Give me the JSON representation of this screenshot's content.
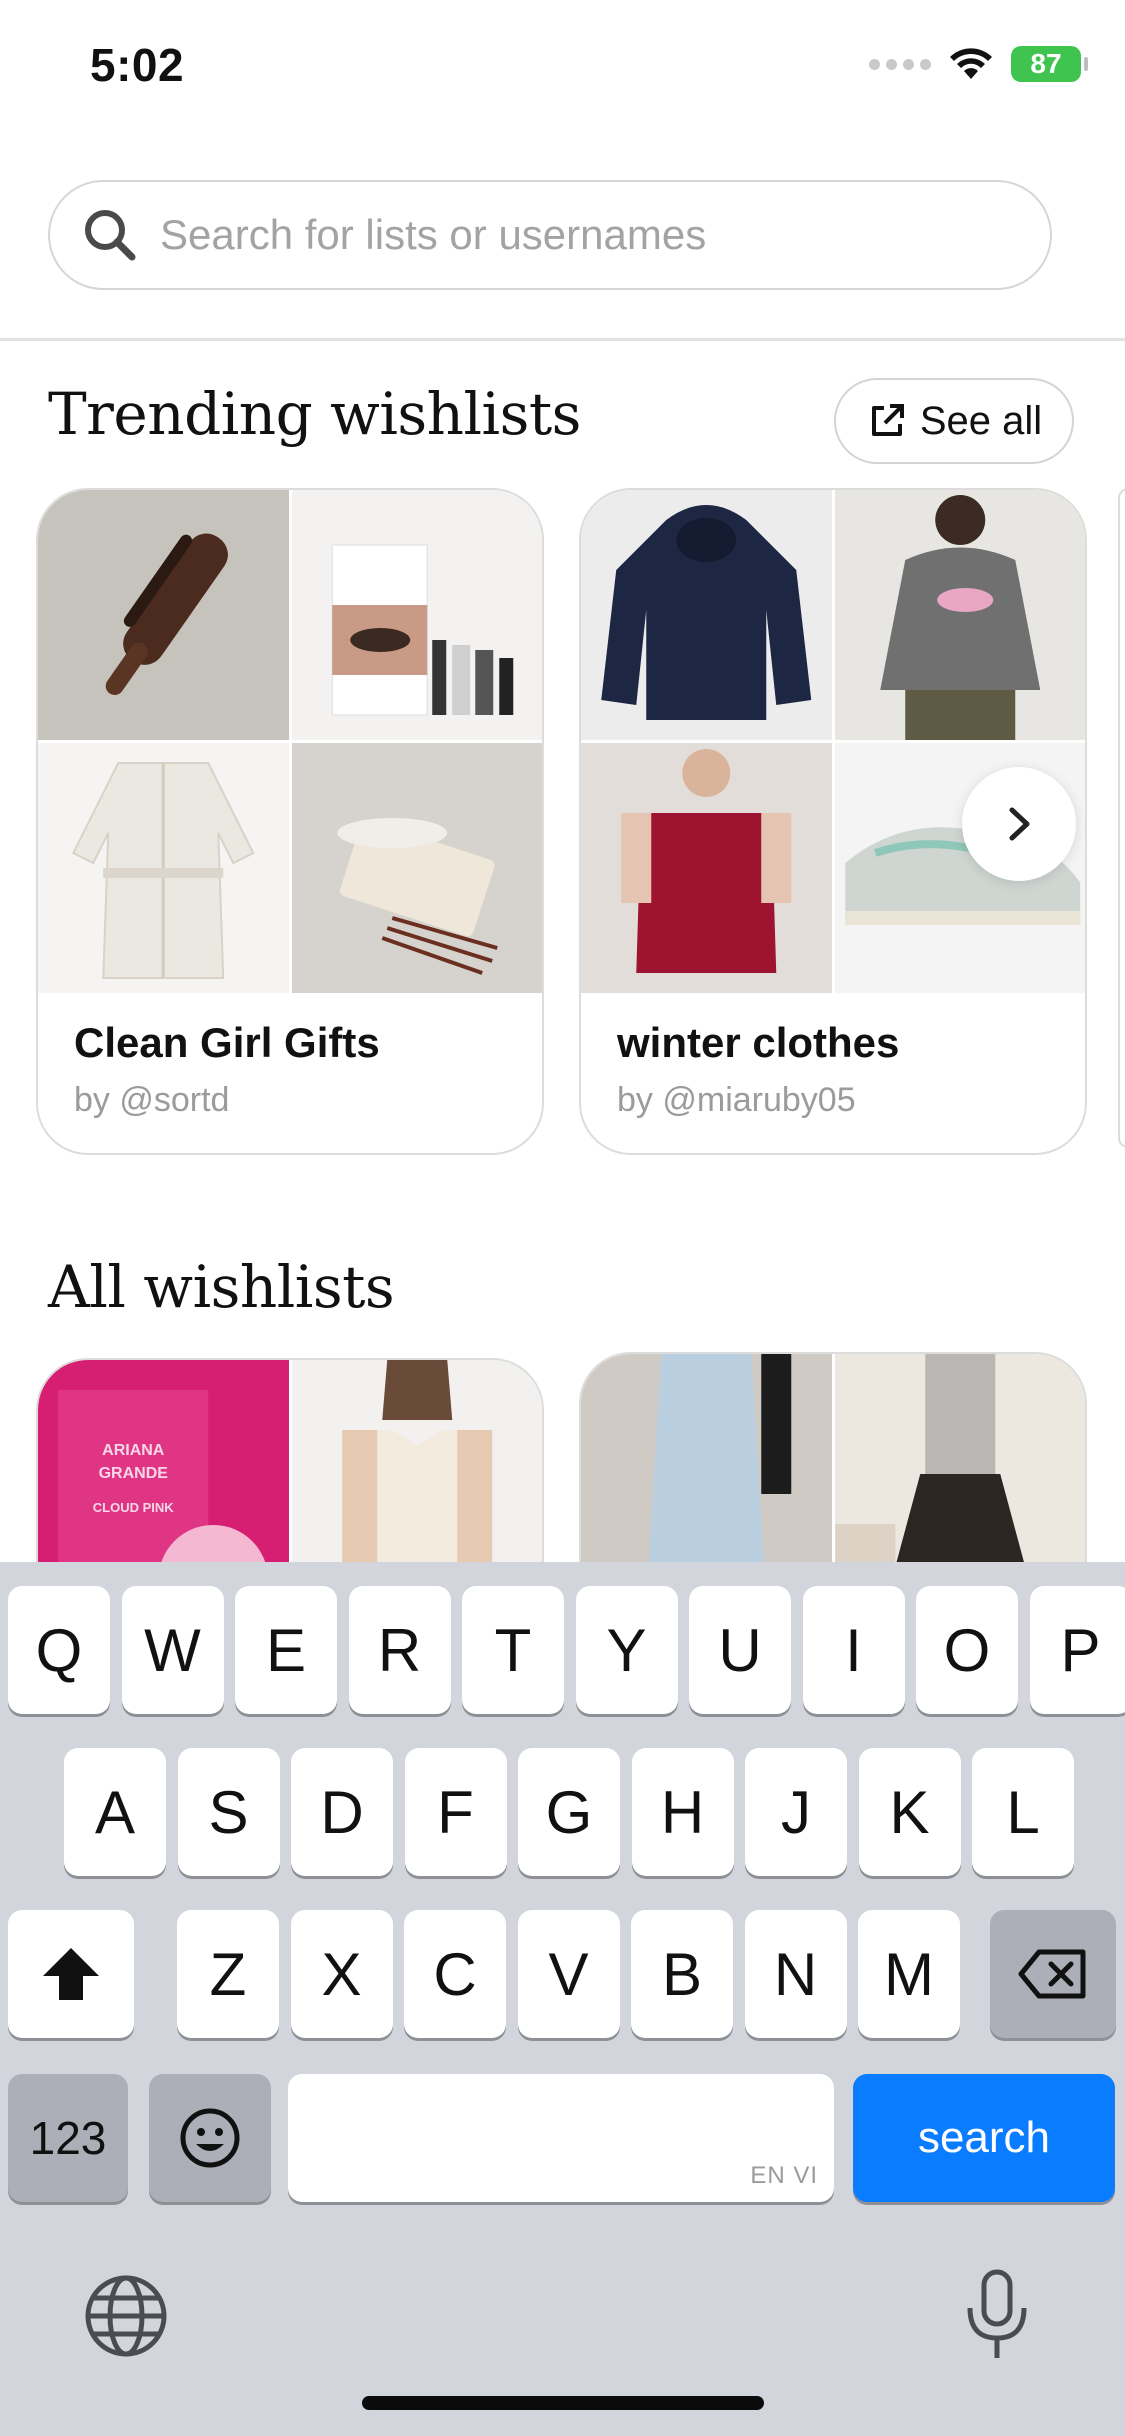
{
  "status_bar": {
    "time": "5:02",
    "battery": "87"
  },
  "search": {
    "placeholder": "Search for lists or usernames",
    "value": ""
  },
  "trending": {
    "title": "Trending wishlists",
    "see_all_label": "See all",
    "cards": [
      {
        "title": "Clean Girl Gifts",
        "author": "by @sortd"
      },
      {
        "title": "winter clothes",
        "author": "by @miaruby05"
      }
    ]
  },
  "all": {
    "title": "All wishlists"
  },
  "keyboard": {
    "row1": [
      "Q",
      "W",
      "E",
      "R",
      "T",
      "Y",
      "U",
      "I",
      "O",
      "P"
    ],
    "row2": [
      "A",
      "S",
      "D",
      "F",
      "G",
      "H",
      "J",
      "K",
      "L"
    ],
    "row3": [
      "Z",
      "X",
      "C",
      "V",
      "B",
      "N",
      "M"
    ],
    "numbers_label": "123",
    "space_sub": "EN VI",
    "search_label": "search"
  },
  "colors": {
    "accent": "#0a7cff",
    "battery": "#3fc450",
    "keyboard_bg": "#d3d5dc"
  }
}
